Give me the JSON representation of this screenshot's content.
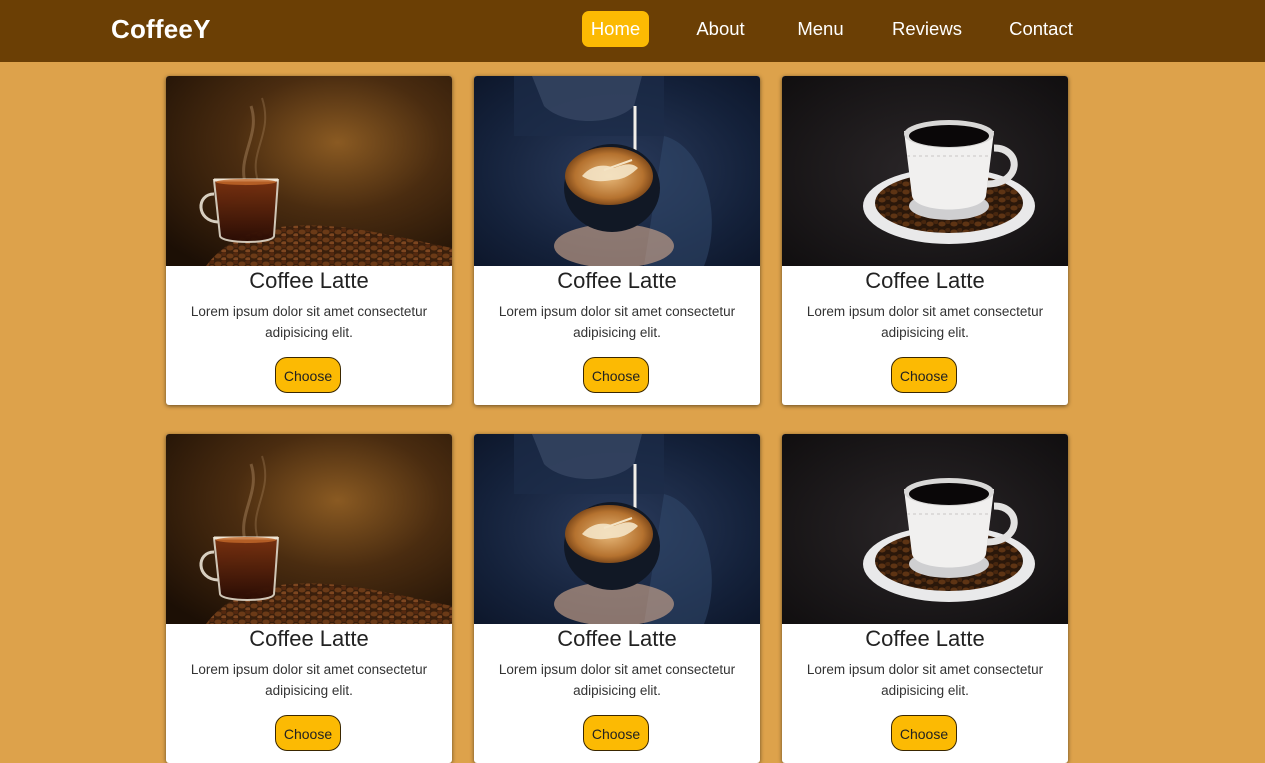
{
  "brand": "CoffeeY",
  "nav": {
    "items": [
      {
        "label": "Home",
        "active": true
      },
      {
        "label": "About",
        "active": false
      },
      {
        "label": "Menu",
        "active": false
      },
      {
        "label": "Reviews",
        "active": false
      },
      {
        "label": "Contact",
        "active": false
      }
    ]
  },
  "colors": {
    "page_background": "#dda24b",
    "navbar": "#6b3f05",
    "accent": "#fcba03"
  },
  "cards": [
    {
      "image": "glass-coffee-with-beans-photo",
      "title": "Coffee Latte",
      "text": "Lorem ipsum dolor sit amet consectetur adipisicing elit.",
      "button": "Choose"
    },
    {
      "image": "latte-art-pour-photo",
      "title": "Coffee Latte",
      "text": "Lorem ipsum dolor sit amet consectetur adipisicing elit.",
      "button": "Choose"
    },
    {
      "image": "white-cup-on-saucer-photo",
      "title": "Coffee Latte",
      "text": "Lorem ipsum dolor sit amet consectetur adipisicing elit.",
      "button": "Choose"
    },
    {
      "image": "glass-coffee-with-beans-photo",
      "title": "Coffee Latte",
      "text": "Lorem ipsum dolor sit amet consectetur adipisicing elit.",
      "button": "Choose"
    },
    {
      "image": "latte-art-pour-photo",
      "title": "Coffee Latte",
      "text": "Lorem ipsum dolor sit amet consectetur adipisicing elit.",
      "button": "Choose"
    },
    {
      "image": "white-cup-on-saucer-photo",
      "title": "Coffee Latte",
      "text": "Lorem ipsum dolor sit amet consectetur adipisicing elit.",
      "button": "Choose"
    }
  ]
}
